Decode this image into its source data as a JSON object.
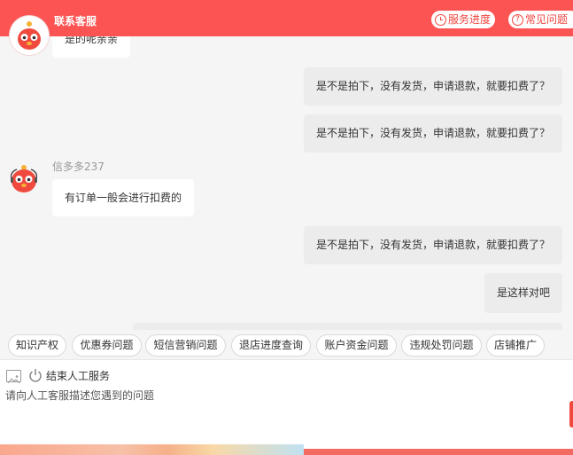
{
  "header": {
    "title": "联系客服",
    "progress_label": "服务进度",
    "faq_label": "常见问题"
  },
  "colors": {
    "brand": "#fc5453",
    "bubble_outgoing": "#ececec",
    "bubble_incoming": "#ffffff"
  },
  "messages": [
    {
      "side": "incoming",
      "text": "是的呢亲亲"
    },
    {
      "side": "outgoing",
      "text": "是不是拍下，没有发货，申请退款，就要扣费了？"
    },
    {
      "side": "outgoing",
      "text": "是不是拍下，没有发货，申请退款，就要扣费了？"
    },
    {
      "side": "incoming",
      "sender": "信多多237",
      "text": "有订单一般会进行扣费的"
    },
    {
      "side": "outgoing",
      "text": "是不是拍下，没有发货，申请退款，就要扣费了？"
    },
    {
      "side": "outgoing",
      "text": "是这样对吧"
    }
  ],
  "quick_tags": [
    "知识产权",
    "优惠券问题",
    "短信营销问题",
    "退店进度查询",
    "账户资金问题",
    "违规处罚问题",
    "店铺推广"
  ],
  "input": {
    "end_service_label": "结束人工服务",
    "placeholder": "请向人工客服描述您遇到的问题",
    "value": ""
  },
  "icons": [
    "mascot-avatar",
    "clock-icon",
    "question-icon",
    "image-icon",
    "power-icon"
  ]
}
